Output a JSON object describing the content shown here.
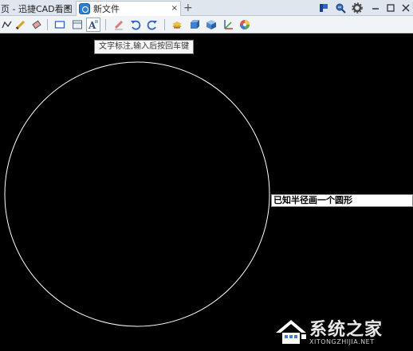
{
  "tabs": [
    {
      "label": "页 - 迅捷CAD看图",
      "active": false,
      "close": "×"
    },
    {
      "label": "新文件",
      "active": true,
      "close": "×"
    }
  ],
  "new_tab_label": "+",
  "window_controls": [
    "flag-icon",
    "zoom-icon",
    "gear-icon",
    "minimize-icon",
    "maximize-icon",
    "close-icon"
  ],
  "toolbar": {
    "items": [
      "polyline-icon",
      "pencil-icon",
      "eraser-icon",
      "rectangle-icon",
      "layout-icon",
      "text-annotation-icon",
      "highlighter-icon",
      "undo-icon",
      "redo-icon",
      "layers-icon",
      "3d-box-icon",
      "cube-icon",
      "axes-icon",
      "color-wheel-icon"
    ],
    "pressed": "text-annotation-icon"
  },
  "tooltip": {
    "text": "文字标注,输入后按回车键"
  },
  "canvas": {
    "background": "#000000",
    "shape": "circle",
    "input_value": "已知半径画一个圆形"
  },
  "watermark": {
    "brand": "系统之家",
    "url": "XITONGZHIJIA.NET"
  },
  "colors": {
    "accent": "#2f7fd0",
    "tab_bar": "#dfe6ee",
    "toolbar": "#f1f4f7",
    "stroke": "#ffffff"
  }
}
